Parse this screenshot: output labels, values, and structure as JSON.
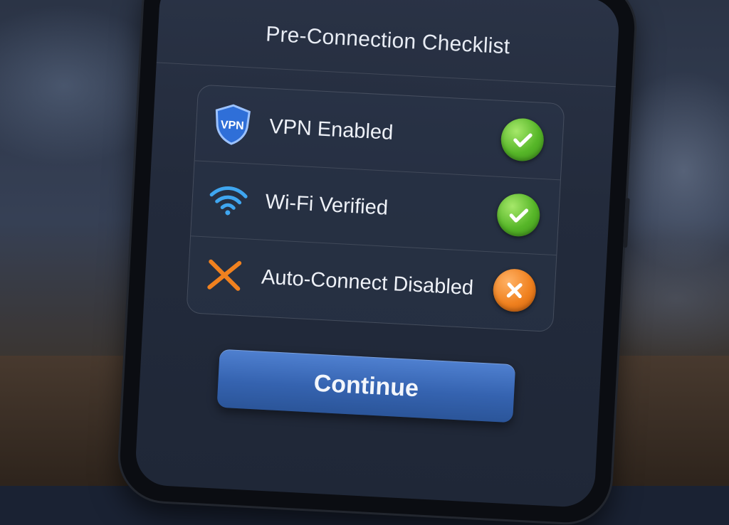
{
  "screen": {
    "title": "Pre-Connection Checklist"
  },
  "checklist": {
    "items": [
      {
        "label": "VPN Enabled",
        "icon": "vpn-shield-icon",
        "status": "passed",
        "status_icon": "checkmark-icon"
      },
      {
        "label": "Wi-Fi Verified",
        "icon": "wifi-icon",
        "status": "passed",
        "status_icon": "checkmark-icon"
      },
      {
        "label": "Auto-Connect Disabled",
        "icon": "cross-mark-icon",
        "status": "failed",
        "status_icon": "x-mark-icon"
      }
    ]
  },
  "actions": {
    "continue_label": "Continue"
  },
  "colors": {
    "pass": "#56b628",
    "fail": "#f0811f",
    "accent": "#3563b0"
  }
}
